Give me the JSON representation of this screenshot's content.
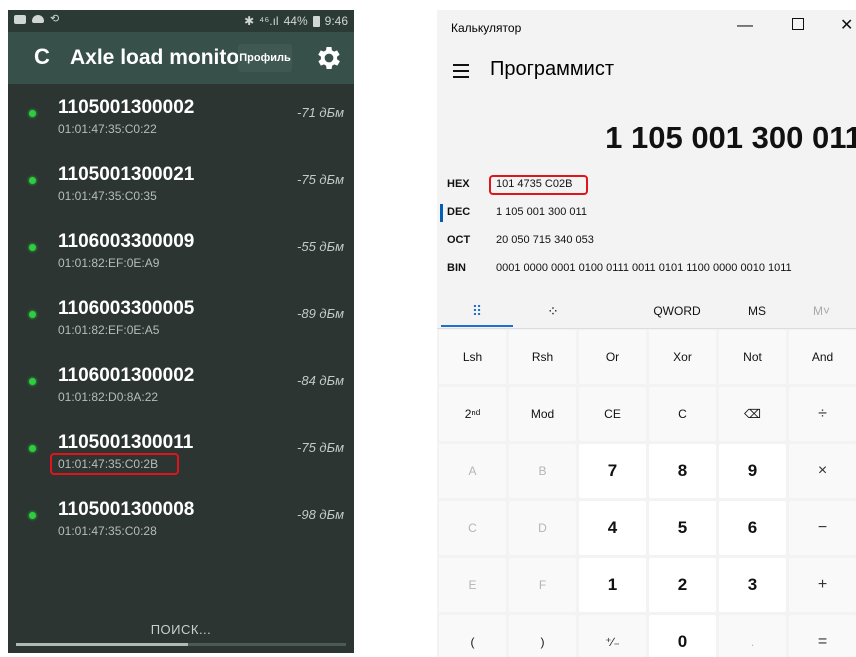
{
  "phone": {
    "status": {
      "left_icons": [
        "message-icon",
        "cloud-icon",
        "sync-icon"
      ],
      "bluetooth": "✱",
      "signal": "⁴⁶.ıl",
      "battery": "44%",
      "time": "9:46"
    },
    "app_title": "Axle load monitor",
    "profile_label": "Профиль",
    "devices": [
      {
        "id": "1105001300002",
        "mac": "01:01:47:35:C0:22",
        "rssi": "-71 дБм"
      },
      {
        "id": "1105001300021",
        "mac": "01:01:47:35:C0:35",
        "rssi": "-75 дБм"
      },
      {
        "id": "1106003300009",
        "mac": "01:01:82:EF:0E:A9",
        "rssi": "-55 дБм"
      },
      {
        "id": "1106003300005",
        "mac": "01:01:82:EF:0E:A5",
        "rssi": "-89 дБм"
      },
      {
        "id": "1106001300002",
        "mac": "01:01:82:D0:8A:22",
        "rssi": "-84 дБм"
      },
      {
        "id": "1105001300011",
        "mac": "01:01:47:35:C0:2B",
        "rssi": "-75 дБм"
      },
      {
        "id": "1105001300008",
        "mac": "01:01:47:35:C0:28",
        "rssi": "-98 дБм"
      }
    ],
    "highlighted_device_index": 5,
    "search_label": "ПОИСК...",
    "search_progress": 0.52,
    "colors": {
      "appbar": "#38504a",
      "background": "#2c3531",
      "online_dot": "#2ecc40",
      "highlight": "#e0151c"
    }
  },
  "calculator": {
    "window_title": "Калькулятор",
    "controls": {
      "minimize": "—",
      "close": "✕"
    },
    "mode": "Программист",
    "display": "1 105 001 300 011",
    "bases": [
      {
        "name": "HEX",
        "value": "101 4735 C02B"
      },
      {
        "name": "DEC",
        "value": "1 105 001 300 011"
      },
      {
        "name": "OCT",
        "value": "20 050 715 340 053"
      },
      {
        "name": "BIN",
        "value": "0001 0000 0001 0100 0111 0011 0101 1100 0000 0010 1011"
      }
    ],
    "tabs": {
      "keypad_icon": "⠿",
      "bitflip_icon": "⁘",
      "word": "QWORD",
      "ms": "MS",
      "mv": "M˅"
    },
    "keys": [
      [
        "Lsh",
        "Rsh",
        "Or",
        "Xor",
        "Not",
        "And"
      ],
      [
        "2ⁿᵈ",
        "Mod",
        "CE",
        "C",
        "⌫",
        "÷"
      ],
      [
        "A",
        "B",
        "7",
        "8",
        "9",
        "×"
      ],
      [
        "C",
        "D",
        "4",
        "5",
        "6",
        "−"
      ],
      [
        "E",
        "F",
        "1",
        "2",
        "3",
        "+"
      ],
      [
        "(",
        ")",
        "⁺∕₋",
        "0",
        ".",
        "="
      ]
    ],
    "colors": {
      "accent": "#1e6fd0",
      "highlight": "#e0151c"
    }
  }
}
